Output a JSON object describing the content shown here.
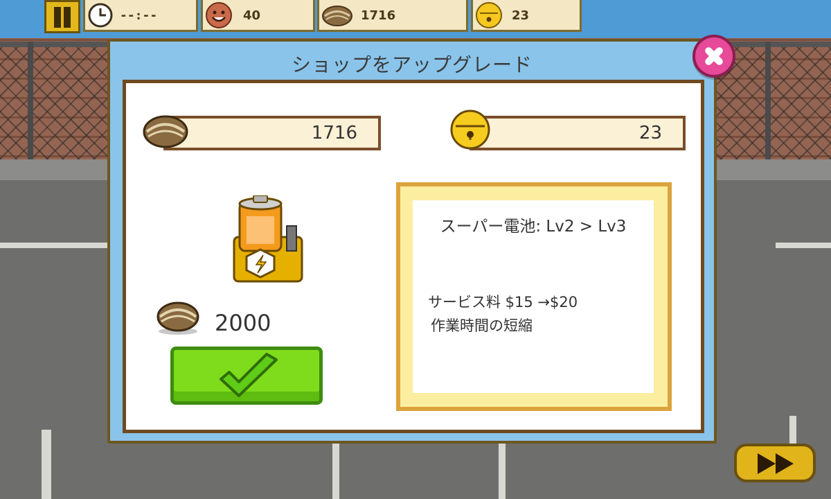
{
  "hud": {
    "timer": "--:--",
    "customers": "40",
    "nuts": "1716",
    "bells": "23"
  },
  "dialog": {
    "title": "ショップをアップグレード",
    "nuts_balance": "1716",
    "bells_balance": "23",
    "cost": "2000",
    "upgrade_title": "スーパー電池: Lv2 > Lv3",
    "effect_line_1": "サービス料 $15 →$20",
    "effect_line_2": "作業時間の短縮"
  },
  "icons": {
    "pause": "pause-icon",
    "clock": "clock-icon",
    "customer": "smiley-face-icon",
    "nut": "walnut-icon",
    "bell": "golden-bell-icon",
    "close": "close-x-icon",
    "confirm": "checkmark-icon",
    "item": "super-battery-icon",
    "fast_forward": "fast-forward-icon"
  },
  "colors": {
    "dialog_bg": "#8ac4ea",
    "confirm_green": "#7fdc1c",
    "close_pink": "#e64a98",
    "info_border": "#dba33e"
  }
}
